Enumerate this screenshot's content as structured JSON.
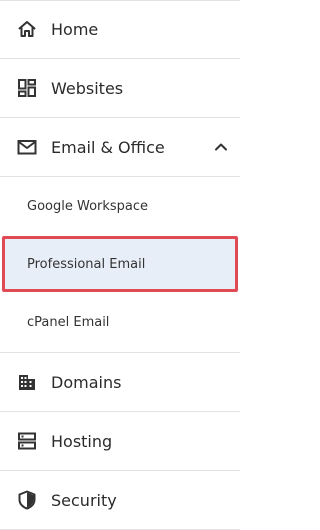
{
  "nav": {
    "home": {
      "label": "Home",
      "icon": "home-icon"
    },
    "websites": {
      "label": "Websites",
      "icon": "websites-icon"
    },
    "email_office": {
      "label": "Email & Office",
      "icon": "mail-icon",
      "expanded": true,
      "children": [
        {
          "label": "Google Workspace"
        },
        {
          "label": "Professional Email",
          "selected": true
        },
        {
          "label": "cPanel Email"
        }
      ]
    },
    "domains": {
      "label": "Domains",
      "icon": "domains-icon"
    },
    "hosting": {
      "label": "Hosting",
      "icon": "hosting-icon"
    },
    "security": {
      "label": "Security",
      "icon": "shield-icon"
    }
  },
  "colors": {
    "selected_background": "#e8eef8",
    "highlight_outline": "#e04a55",
    "divider": "#e2e2e2"
  }
}
